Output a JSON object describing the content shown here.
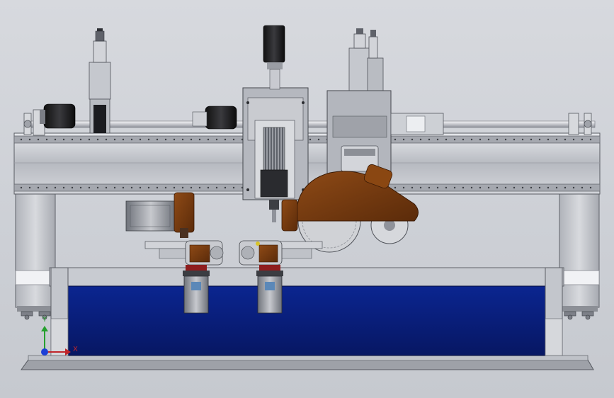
{
  "viewport": {
    "background_top": "#d7d9de",
    "background_bottom": "#c6c9cf"
  },
  "colors": {
    "steel": "#b9bcc3",
    "steel_dark": "#6e727a",
    "steel_light": "#e4e6ea",
    "tank_blue": "#0a1f80",
    "motor_brown": "#7a3d10",
    "motor_brown_dark": "#4a2208",
    "motor_black": "#1b1b1d",
    "rail_shaft": "#e8e8ec",
    "axis_x": "#c0262b",
    "axis_y": "#25a02e",
    "axis_origin": "#1d3fd6"
  },
  "triad": {
    "x_label": "X",
    "y_label": "Y",
    "icon": "coordinate-triad-icon"
  }
}
